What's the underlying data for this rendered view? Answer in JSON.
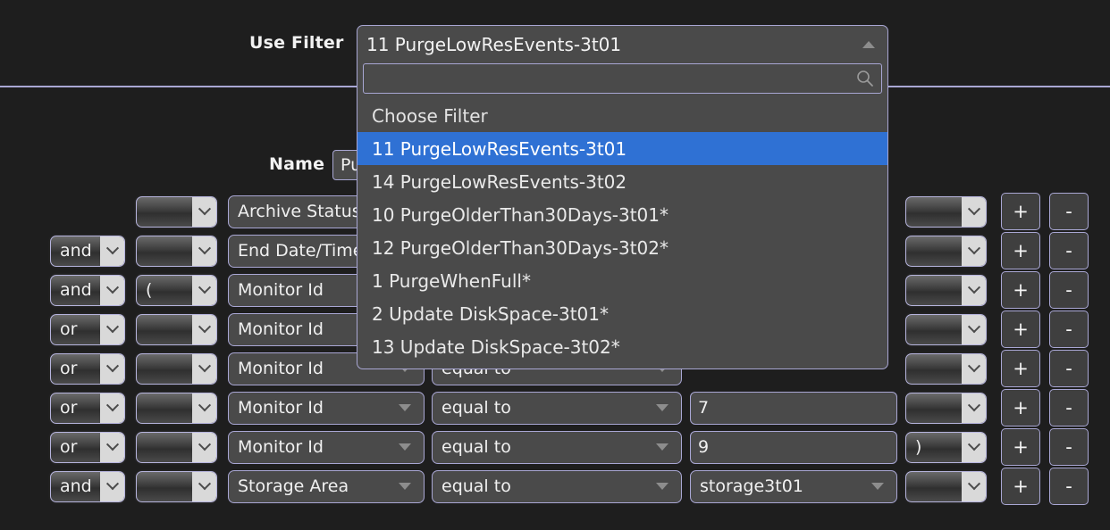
{
  "form": {
    "use_filter_label": "Use Filter",
    "name_label": "Name",
    "name_value": "Pu"
  },
  "dropdown": {
    "selected_label": "11 PurgeLowResEvents-3t01",
    "search_value": "",
    "search_placeholder": "",
    "search_icon": "search-icon",
    "collapse_icon": "caret-up-icon",
    "placeholder_item": "Choose Filter",
    "items": [
      "11 PurgeLowResEvents-3t01",
      "14 PurgeLowResEvents-3t02",
      "10 PurgeOlderThan30Days-3t01*",
      "12 PurgeOlderThan30Days-3t02*",
      "1 PurgeWhenFull*",
      "2 Update DiskSpace-3t01*",
      "13 Update DiskSpace-3t02*"
    ],
    "selected_index": 0,
    "highlight_color": "#2f71d4"
  },
  "buttons": {
    "add_label": "+",
    "remove_label": "-"
  },
  "colors": {
    "background": "#1e1e1e",
    "panel": "#4a4a4a",
    "border": "#a9a7d4",
    "text": "#f0f0f0",
    "accent": "#2f71d4"
  },
  "rows": [
    {
      "logic": "",
      "logic_visible": false,
      "paren_open": "",
      "field": "Archive Status",
      "operator": "",
      "value": "",
      "value_type": "hidden",
      "paren_close": "",
      "add": "+",
      "remove": "-"
    },
    {
      "logic": "and",
      "logic_visible": true,
      "paren_open": "",
      "field": "End Date/Time",
      "operator": "",
      "value": "",
      "value_type": "hidden",
      "paren_close": "",
      "add": "+",
      "remove": "-"
    },
    {
      "logic": "and",
      "logic_visible": true,
      "paren_open": "(",
      "field": "Monitor Id",
      "operator": "",
      "value": "",
      "value_type": "hidden",
      "paren_close": "",
      "add": "+",
      "remove": "-"
    },
    {
      "logic": "or",
      "logic_visible": true,
      "paren_open": "",
      "field": "Monitor Id",
      "operator": "",
      "value": "",
      "value_type": "hidden",
      "paren_close": "",
      "add": "+",
      "remove": "-"
    },
    {
      "logic": "or",
      "logic_visible": true,
      "paren_open": "",
      "field": "Monitor Id",
      "operator": "equal to",
      "value": "",
      "value_type": "hidden",
      "paren_close": "",
      "add": "+",
      "remove": "-"
    },
    {
      "logic": "or",
      "logic_visible": true,
      "paren_open": "",
      "field": "Monitor Id",
      "operator": "equal to",
      "value": "7",
      "value_type": "input",
      "paren_close": "",
      "add": "+",
      "remove": "-"
    },
    {
      "logic": "or",
      "logic_visible": true,
      "paren_open": "",
      "field": "Monitor Id",
      "operator": "equal to",
      "value": "9",
      "value_type": "input",
      "paren_close": ")",
      "add": "+",
      "remove": "-"
    },
    {
      "logic": "and",
      "logic_visible": true,
      "paren_open": "",
      "field": "Storage Area",
      "operator": "equal to",
      "value": "storage3t01",
      "value_type": "select",
      "paren_close": "",
      "add": "+",
      "remove": "-"
    }
  ]
}
